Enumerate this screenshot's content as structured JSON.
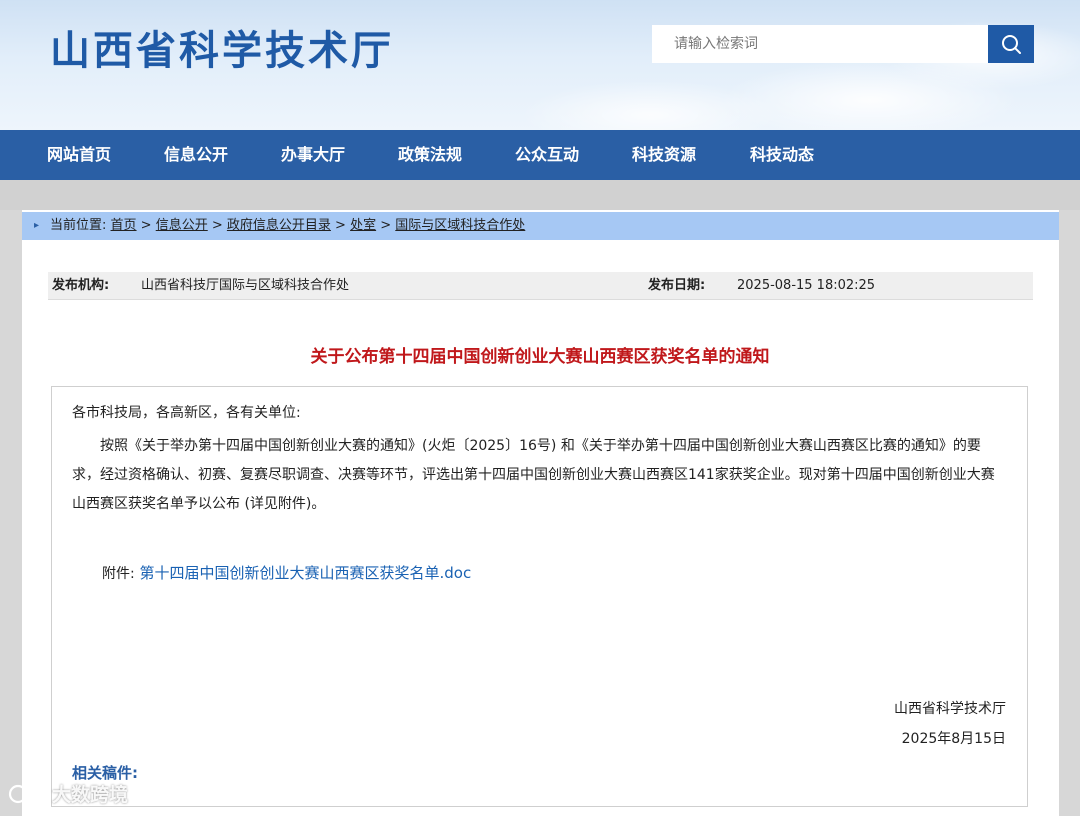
{
  "header": {
    "site_title": "山西省科学技术厅",
    "search_placeholder": "请输入检索词"
  },
  "nav": {
    "items": [
      "网站首页",
      "信息公开",
      "办事大厅",
      "政策法规",
      "公众互动",
      "科技资源",
      "科技动态"
    ]
  },
  "breadcrumb": {
    "label": "当前位置:",
    "items": [
      "首页",
      "信息公开",
      "政府信息公开目录",
      "处室",
      "国际与区域科技合作处"
    ]
  },
  "meta": {
    "publisher_label": "发布机构:",
    "publisher_value": "山西省科技厅国际与区域科技合作处",
    "date_label": "发布日期:",
    "date_value": "2025-08-15 18:02:25"
  },
  "article": {
    "title": "关于公布第十四届中国创新创业大赛山西赛区获奖名单的通知",
    "salutation": "各市科技局，各高新区，各有关单位:",
    "body": "按照《关于举办第十四届中国创新创业大赛的通知》(火炬〔2025〕16号) 和《关于举办第十四届中国创新创业大赛山西赛区比赛的通知》的要求，经过资格确认、初赛、复赛尽职调查、决赛等环节，评选出第十四届中国创新创业大赛山西赛区141家获奖企业。现对第十四届中国创新创业大赛山西赛区获奖名单予以公布 (详见附件)。",
    "attachment_label": "附件:",
    "attachment_link": "第十四届中国创新创业大赛山西赛区获奖名单.doc",
    "signature_org": "山西省科学技术厅",
    "signature_date": "2025年8月15日",
    "related_label": "相关稿件:"
  },
  "watermark": {
    "text": "大数跨境"
  },
  "colors": {
    "brand_blue": "#2a5fa5",
    "title_red": "#c0181b",
    "link_blue": "#1a62b3",
    "breadcrumb_bg": "#a6c8f4"
  }
}
